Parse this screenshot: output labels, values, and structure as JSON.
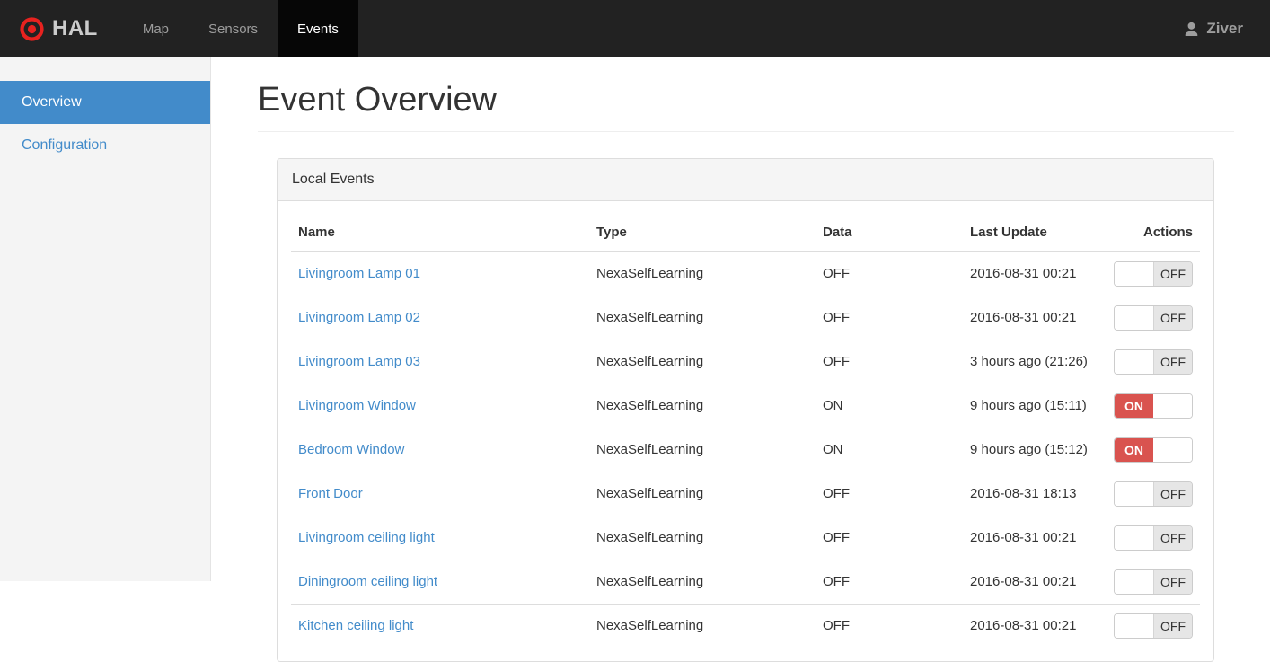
{
  "navbar": {
    "brand": "HAL",
    "items": [
      {
        "label": "Map",
        "active": false
      },
      {
        "label": "Sensors",
        "active": false
      },
      {
        "label": "Events",
        "active": true
      }
    ],
    "user": "Ziver"
  },
  "sidebar": {
    "items": [
      {
        "label": "Overview",
        "active": true
      },
      {
        "label": "Configuration",
        "active": false
      }
    ]
  },
  "main": {
    "title": "Event Overview",
    "panel": {
      "title": "Local Events",
      "table": {
        "columns": [
          "Name",
          "Type",
          "Data",
          "Last Update",
          "Actions"
        ],
        "rows": [
          {
            "name": "Livingroom Lamp 01",
            "type": "NexaSelfLearning",
            "data": "OFF",
            "last_update": "2016-08-31 00:21",
            "state": "OFF"
          },
          {
            "name": "Livingroom Lamp 02",
            "type": "NexaSelfLearning",
            "data": "OFF",
            "last_update": "2016-08-31 00:21",
            "state": "OFF"
          },
          {
            "name": "Livingroom Lamp 03",
            "type": "NexaSelfLearning",
            "data": "OFF",
            "last_update": "3 hours ago (21:26)",
            "state": "OFF"
          },
          {
            "name": "Livingroom Window",
            "type": "NexaSelfLearning",
            "data": "ON",
            "last_update": "9 hours ago (15:11)",
            "state": "ON"
          },
          {
            "name": "Bedroom Window",
            "type": "NexaSelfLearning",
            "data": "ON",
            "last_update": "9 hours ago (15:12)",
            "state": "ON"
          },
          {
            "name": "Front Door",
            "type": "NexaSelfLearning",
            "data": "OFF",
            "last_update": "2016-08-31 18:13",
            "state": "OFF"
          },
          {
            "name": "Livingroom ceiling light",
            "type": "NexaSelfLearning",
            "data": "OFF",
            "last_update": "2016-08-31 00:21",
            "state": "OFF"
          },
          {
            "name": "Diningroom ceiling light",
            "type": "NexaSelfLearning",
            "data": "OFF",
            "last_update": "2016-08-31 00:21",
            "state": "OFF"
          },
          {
            "name": "Kitchen ceiling light",
            "type": "NexaSelfLearning",
            "data": "OFF",
            "last_update": "2016-08-31 00:21",
            "state": "OFF"
          }
        ]
      }
    }
  },
  "colors": {
    "navbar_bg": "#222222",
    "navbar_active_bg": "#060606",
    "accent_blue": "#428bca",
    "toggle_on_red": "#d9534f",
    "logo_red": "#e8221f",
    "panel_border": "#dddddd",
    "panel_heading_bg": "#f5f5f5",
    "sidebar_bg": "#f4f4f4"
  }
}
